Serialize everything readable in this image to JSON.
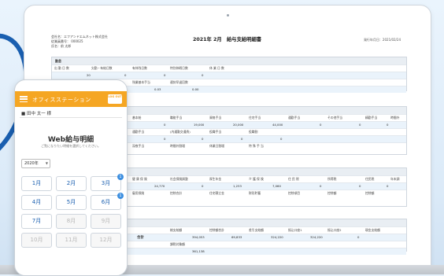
{
  "header": {
    "company": "会社名：エフアンドエムネット株式会社",
    "code": "従業員番号： 000025",
    "name": "氏名：前 太郎",
    "title": "2021年 2月　給与支給明細書",
    "date": "発行年月日：2021/02/24"
  },
  "sections": {
    "s1": "勤怠",
    "s2": "支給",
    "s3": "控除",
    "s4": "合計"
  },
  "cells": {
    "r1": [
      "出 勤 日 数",
      "欠勤・有給日数",
      "有休残日数",
      "特別休暇日数",
      "休 業 日 数"
    ],
    "v1": [
      "20",
      "0",
      "0",
      "0"
    ],
    "r2": [
      "",
      "",
      "残業基本手当",
      "遅刻早退回数"
    ],
    "v2": [
      "0.03",
      "0.00"
    ],
    "p1": [
      "基本給",
      "職能手当",
      "資格手当",
      "住宅手当",
      "通勤手当",
      "その他手当",
      "精勤手当",
      "時間外"
    ],
    "p1v": [
      "0",
      "19,000",
      "20,000",
      "44,000",
      "0",
      "0",
      "0"
    ],
    "p2": [
      "通勤手当",
      "(内通勤交通費)",
      "役職手当",
      "役職割"
    ],
    "p2v": [
      "0",
      "0",
      "0",
      "0"
    ],
    "p3": [
      "深夜手当",
      "時間外割増",
      "休業日割増",
      "特 殊 手 当"
    ],
    "p3v": [
      "0",
      "1,440",
      "0"
    ],
    "d1": [
      "健 康 保 険",
      "社会保険調整",
      "厚生年金",
      "介 護 保 険",
      "住 民 税",
      "所得税",
      "住民税",
      "年末調"
    ],
    "d1v": [
      "24,770",
      "0",
      "1,233",
      "7,060",
      "0",
      "0",
      "0"
    ],
    "d2": [
      "雇用保険",
      "控除合計",
      "住宅積立金",
      "財形貯蓄",
      "控除項目",
      "控除額",
      "控除額"
    ],
    "t1": [
      "総支給額",
      "控除額合計",
      "差引支給額",
      "振込口座1",
      "振込口座2",
      "現金支給額"
    ],
    "t1v": [
      "394,053",
      "69,833",
      "324,220",
      "324,220",
      "0"
    ],
    "total": "合計",
    "t2": [
      "課税対象額"
    ],
    "t2v": [
      "361,138"
    ]
  },
  "phone": {
    "app": "オフィスステーション",
    "logout": "LOG OUT",
    "user": "田中 太一 様",
    "webtitle": "Web給与明細",
    "websub": "ご覧になりたい明細を選択してください。",
    "year": "2020年",
    "months": [
      "1月",
      "2月",
      "3月",
      "4月",
      "5月",
      "6月",
      "7月",
      "8月",
      "9月",
      "10月",
      "11月",
      "12月"
    ],
    "badge": "1"
  }
}
